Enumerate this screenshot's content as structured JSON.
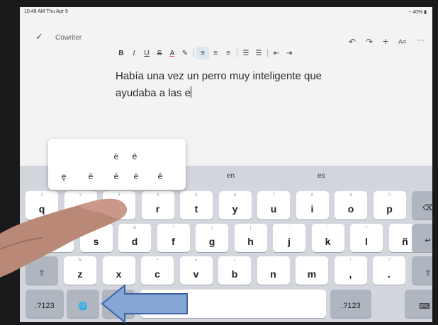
{
  "status": {
    "time": "10:48 AM  Thu Apr 9",
    "battery": "40%"
  },
  "appbar": {
    "doc_name": "Cowriter",
    "checkmark_icon": "checkmark-icon",
    "undo_icon": "undo-icon",
    "redo_icon": "redo-icon",
    "add_icon": "plus-icon",
    "text_format_icon": "text-format-icon",
    "more_icon": "more-icon"
  },
  "format_toolbar": [
    {
      "id": "bold",
      "label": "B"
    },
    {
      "id": "italic",
      "label": "I"
    },
    {
      "id": "underline",
      "label": "U"
    },
    {
      "id": "strikethrough",
      "label": "S"
    },
    {
      "id": "text-color",
      "label": "A"
    },
    {
      "id": "highlight",
      "label": "✎"
    },
    {
      "id": "align-left",
      "label": "≡"
    },
    {
      "id": "align-center",
      "label": "≡"
    },
    {
      "id": "align-right",
      "label": "≡"
    },
    {
      "id": "bulleted-list",
      "label": "☰"
    },
    {
      "id": "numbered-list",
      "label": "☰"
    },
    {
      "id": "decrease-indent",
      "label": "⇤"
    },
    {
      "id": "increase-indent",
      "label": "⇥"
    }
  ],
  "document": {
    "line1": "Había una vez un perro muy inteligente que",
    "line2": "ayudaba a las e"
  },
  "predictions": {
    "left": "en",
    "right": "es"
  },
  "accent_popup": {
    "row1": [
      "ė",
      "ē"
    ],
    "row2": [
      "ę",
      "ë",
      "é",
      "è",
      "ê"
    ]
  },
  "keyboard": {
    "row1": [
      {
        "h": "1",
        "k": "q"
      },
      {
        "h": "2",
        "k": "w"
      },
      {
        "h": "3",
        "k": "e"
      },
      {
        "h": "4",
        "k": "r"
      },
      {
        "h": "5",
        "k": "t"
      },
      {
        "h": "6",
        "k": "y"
      },
      {
        "h": "7",
        "k": "u"
      },
      {
        "h": "8",
        "k": "i"
      },
      {
        "h": "9",
        "k": "o"
      },
      {
        "h": "0",
        "k": "p"
      }
    ],
    "row2": [
      {
        "h": "@",
        "k": "a"
      },
      {
        "h": "$",
        "k": "s"
      },
      {
        "h": "&",
        "k": "d"
      },
      {
        "h": "*",
        "k": "f"
      },
      {
        "h": "(",
        "k": "g"
      },
      {
        "h": ")",
        "k": "h"
      },
      {
        "h": "'",
        "k": "j"
      },
      {
        "h": "\"",
        "k": "k"
      },
      {
        "h": "+",
        "k": "l"
      },
      {
        "h": "",
        "k": "ñ"
      }
    ],
    "row3": [
      {
        "h": "%",
        "k": "z"
      },
      {
        "h": "-",
        "k": "x"
      },
      {
        "h": "^",
        "k": "c"
      },
      {
        "h": "=",
        "k": "v"
      },
      {
        "h": "/",
        "k": "b"
      },
      {
        "h": ";",
        "k": "n"
      },
      {
        "h": ":",
        "k": "m"
      },
      {
        "h": "!",
        "k": ","
      },
      {
        "h": "?",
        "k": "."
      }
    ],
    "numbers_label": ".?123",
    "backspace_icon": "backspace-icon",
    "return_icon": "return-icon",
    "shift_icon": "shift-icon",
    "globe_icon": "globe-icon",
    "hide_keyboard_icon": "keyboard-dismiss-icon"
  },
  "annotation": {
    "arrow_icon": "left-arrow-annotation-icon",
    "arrow_color": "#86a6d8"
  }
}
